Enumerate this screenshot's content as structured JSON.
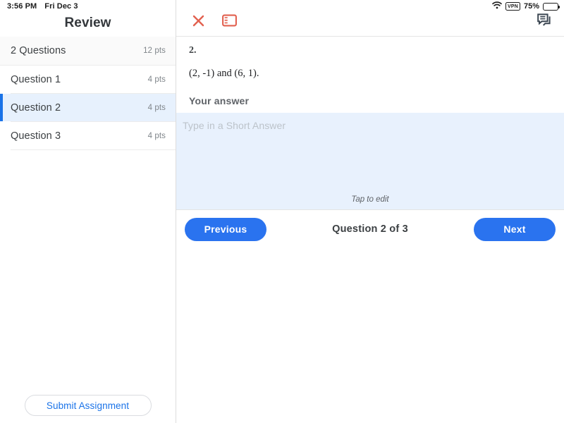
{
  "status_bar": {
    "time": "3:56 PM",
    "date": "Fri Dec 3",
    "wifi_icon": "wifi-icon",
    "vpn_label": "VPN",
    "battery_percent": "75%",
    "battery_level": 75,
    "battery_icon": "battery-icon"
  },
  "sidebar": {
    "title": "Review",
    "summary": {
      "label": "2 Questions",
      "points": "12 pts"
    },
    "items": [
      {
        "label": "Question 1",
        "points": "4 pts",
        "selected": false
      },
      {
        "label": "Question 2",
        "points": "4 pts",
        "selected": true
      },
      {
        "label": "Question 3",
        "points": "4 pts",
        "selected": false
      }
    ],
    "submit_label": "Submit Assignment"
  },
  "toolbar": {
    "close_icon": "close-icon",
    "panel_toggle_icon": "sidebar-toggle-icon",
    "comments_icon": "comments-icon"
  },
  "question": {
    "number": "2.",
    "text": "(2, -1) and (6, 1).",
    "answer_label": "Your answer",
    "answer_value": "",
    "answer_placeholder": "Type in a Short Answer",
    "tap_hint": "Tap to edit"
  },
  "navigation": {
    "previous_label": "Previous",
    "next_label": "Next",
    "counter": "Question 2 of 3"
  },
  "colors": {
    "accent_blue": "#1a73e8",
    "button_blue": "#2a73ef",
    "selected_row_bg": "#e7f1fd",
    "answer_box_bg": "#e8f1fd",
    "toolbar_red": "#e2604f",
    "comments_icon": "#3c4752"
  }
}
